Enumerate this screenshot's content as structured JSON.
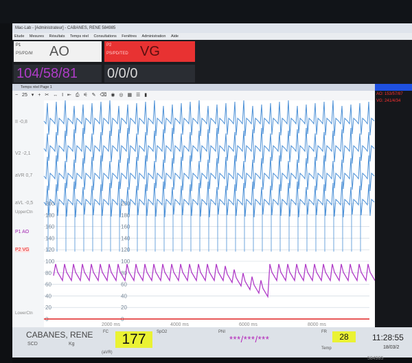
{
  "window": {
    "title": "Mac-Lab - [Administrateur] - CABANES, RENE 584985",
    "menu": [
      "Etude",
      "Mesures",
      "Résultats",
      "Temps réel",
      "Consultations",
      "Fenêtres",
      "Administration",
      "Aide"
    ]
  },
  "pressure_boxes": [
    {
      "label1": "P1",
      "label2": "PS/PD/M",
      "name": "AO",
      "value": "104/58/81",
      "value_color": "#b03cc8"
    },
    {
      "label1": "P2",
      "label2": "PS/PD/TED",
      "name": "VG",
      "value": "0/0/0",
      "value_color": "#d8d8d8"
    }
  ],
  "realtime_window": {
    "title": "Temps réel Page 1",
    "zoom": "25",
    "toolbar_icons": [
      "minus-icon",
      "plus-icon",
      "tools-icon",
      "caliper-icon",
      "text-cursor-icon",
      "split-icon",
      "print-icon",
      "ruler-icon",
      "pencil-icon",
      "eraser-icon",
      "circle-icon",
      "target-icon",
      "grid-icon",
      "list-icon",
      "save-icon"
    ]
  },
  "channel_labels": [
    {
      "text": "II -0,8",
      "color": "#8a8a8a"
    },
    {
      "text": "V2 -2,1",
      "color": "#8a8a8a"
    },
    {
      "text": "aVR 0,7",
      "color": "#8a8a8a"
    },
    {
      "text": "aVL -0,5",
      "color": "#8a8a8a"
    },
    {
      "text": "UpperCtn",
      "color": "#8a8a8a"
    },
    {
      "text": "P1 AO",
      "color": "#a020b0"
    },
    {
      "text": "P2 VG",
      "color": "#e02020"
    },
    {
      "text": "LowerCtn",
      "color": "#8a8a8a"
    }
  ],
  "scale_labels": [
    "200",
    "180",
    "160",
    "140",
    "120",
    "100",
    "80",
    "60",
    "40",
    "20",
    "0"
  ],
  "time_labels": [
    "2000 ms",
    "4000 ms",
    "6000 ms",
    "8000 ms"
  ],
  "sidebar": {
    "ao": "AO: 153/57/87",
    "vg": "VG: 241/4/34"
  },
  "bottom": {
    "patient": "CABANES, RENE",
    "sex": "SCD",
    "weight": "Kg",
    "fc_label": "FC",
    "avr": "(aVR)",
    "heart_rate": "177",
    "spo2_label": "SpO2",
    "pni_label": "PNI",
    "pni_value": "***/***/***",
    "fr_label": "FR",
    "temp_label": "Temp",
    "resp_rate": "28",
    "time": "11:28:55",
    "date": "18/03/2"
  },
  "footer": {
    "serial": "584985"
  },
  "colors": {
    "ecg": "#4a8fd6",
    "ao": "#b03cc8",
    "vg": "#e02020",
    "highlight": "#eaf233"
  }
}
